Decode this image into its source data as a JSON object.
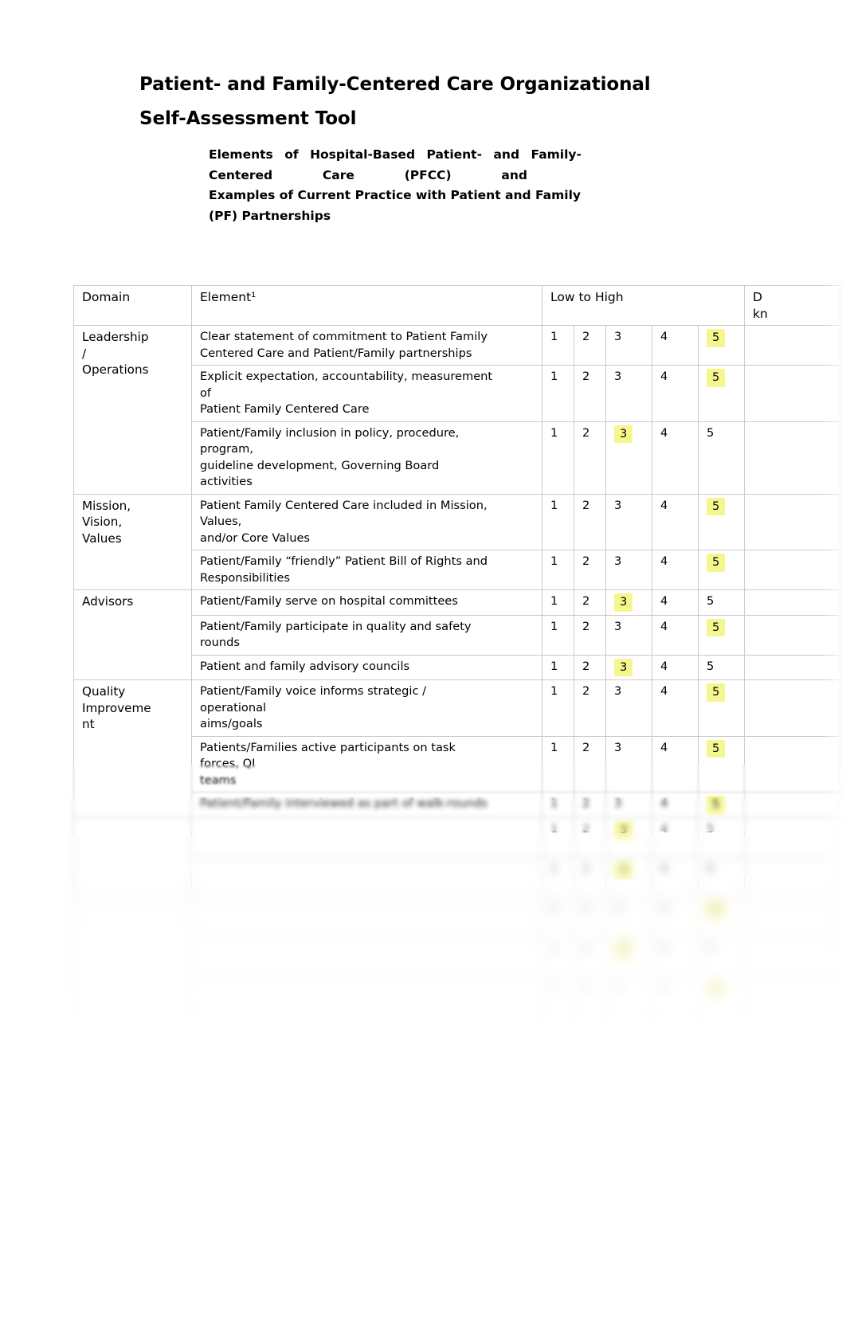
{
  "document": {
    "title": "Patient- and Family-Centered Care Organizational Self-Assessment Tool",
    "subtitle_lines": [
      "Elements  of  Hospital-Based  Patient-  and  Family-",
      "Centered          Care          (PFCC)          and",
      "Examples of Current Practice with Patient and Family",
      "(PF) Partnerships"
    ],
    "subtitle_line2_parts": [
      "Centered",
      "Care",
      "(PFCC)",
      "and"
    ],
    "subtitle_line1_parts": [
      "Elements",
      "of",
      "Hospital-Based",
      "Patient-",
      "and",
      "Family-"
    ]
  },
  "table": {
    "headers": {
      "domain": "Domain",
      "element": "Element¹",
      "low_to_high": "Low to High",
      "dont_know_line1": "D",
      "dont_know_line2": "kn"
    },
    "scale": [
      "1",
      "2",
      "3",
      "4",
      "5"
    ],
    "highlight_color": "#f6f68e",
    "rows": [
      {
        "domain": "Leadership / Operations",
        "domain_lines": [
          "Leadership",
          "/",
          "Operations"
        ],
        "elements": [
          {
            "text": "Clear statement of commitment to Patient Family Centered Care and Patient/Family partnerships",
            "lines": [
              "Clear statement of commitment to Patient Family",
              "Centered Care and Patient/Family partnerships"
            ],
            "selected": "5"
          },
          {
            "text": "Explicit expectation, accountability, measurement of Patient Family Centered Care",
            "lines": [
              "Explicit expectation, accountability, measurement",
              "of",
              "Patient Family Centered Care"
            ],
            "selected": "5"
          },
          {
            "text": "Patient/Family inclusion in policy, procedure, program, guideline development, Governing Board activities",
            "lines": [
              "Patient/Family inclusion in policy, procedure,",
              "program,",
              "guideline development, Governing Board",
              "activities"
            ],
            "selected": "3"
          }
        ]
      },
      {
        "domain": "Mission, Vision, Values",
        "domain_lines": [
          "Mission,",
          "Vision,",
          "Values"
        ],
        "elements": [
          {
            "text": "Patient Family Centered Care included in Mission, Values, and/or Core Values",
            "lines": [
              "Patient Family Centered Care included in Mission,",
              "Values,",
              "and/or Core Values"
            ],
            "selected": "5"
          },
          {
            "text": "Patient/Family “friendly” Patient Bill of Rights and Responsibilities",
            "lines": [
              "Patient/Family “friendly” Patient Bill of Rights and",
              "Responsibilities"
            ],
            "selected": "5"
          }
        ]
      },
      {
        "domain": "Advisors",
        "domain_lines": [
          "Advisors"
        ],
        "elements": [
          {
            "text": "Patient/Family serve on hospital committees",
            "lines": [
              "Patient/Family serve on hospital committees"
            ],
            "selected": "3"
          },
          {
            "text": "Patient/Family participate in quality and safety rounds",
            "lines": [
              "Patient/Family participate in quality and safety",
              "rounds"
            ],
            "selected": "5"
          },
          {
            "text": "Patient and family advisory councils",
            "lines": [
              "Patient and family advisory councils"
            ],
            "selected": "3"
          }
        ]
      },
      {
        "domain": "Quality Improvement",
        "domain_lines": [
          "Quality",
          "Improveme",
          "nt"
        ],
        "elements": [
          {
            "text": "Patient/Family voice informs strategic / operational aims/goals",
            "lines": [
              "Patient/Family voice informs strategic /",
              "operational",
              "aims/goals"
            ],
            "selected": "5"
          },
          {
            "text": "Patients/Families active participants on task forces, QI teams",
            "lines": [
              "Patients/Families active participants on task",
              "forces, QI",
              "teams"
            ],
            "selected": "5"
          },
          {
            "text": "Patient/Family interviewed as part of walk-rounds",
            "lines": [
              "Patient/Family interviewed as part of walk-rounds"
            ],
            "selected": "5"
          }
        ]
      },
      {
        "domain": "",
        "domain_lines": [
          ""
        ],
        "obscured": true,
        "elements": [
          {
            "text": "",
            "lines": [
              "",
              ""
            ],
            "selected": "3",
            "obscured": true
          },
          {
            "text": "",
            "lines": [
              "",
              ""
            ],
            "selected": "3",
            "obscured": true
          }
        ]
      },
      {
        "domain": "",
        "domain_lines": [
          ""
        ],
        "obscured": true,
        "elements": [
          {
            "text": "",
            "lines": [
              "",
              ""
            ],
            "selected": "5",
            "obscured": true
          },
          {
            "text": "",
            "lines": [
              "",
              ""
            ],
            "selected": "3",
            "obscured": true
          },
          {
            "text": "",
            "lines": [
              "",
              ""
            ],
            "selected": "5",
            "obscured": true
          }
        ]
      }
    ]
  }
}
